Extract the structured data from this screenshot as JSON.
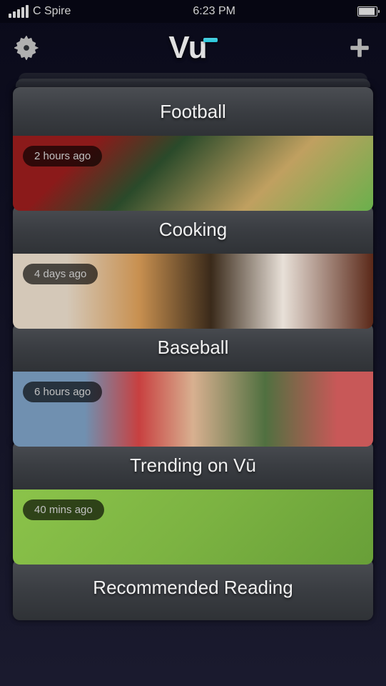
{
  "statusBar": {
    "carrier": "C Spire",
    "time": "6:23 PM"
  },
  "header": {
    "logo": "Vū"
  },
  "cards": [
    {
      "title": "Football",
      "timestamp": "2 hours ago",
      "imageType": "football"
    },
    {
      "title": "Cooking",
      "timestamp": "4 days ago",
      "imageType": "cooking"
    },
    {
      "title": "Baseball",
      "timestamp": "6 hours ago",
      "imageType": "baseball"
    },
    {
      "title": "Trending on Vū",
      "timestamp": "40 mins ago",
      "imageType": "trending"
    },
    {
      "title": "Recommended Reading",
      "timestamp": null,
      "imageType": null
    }
  ]
}
